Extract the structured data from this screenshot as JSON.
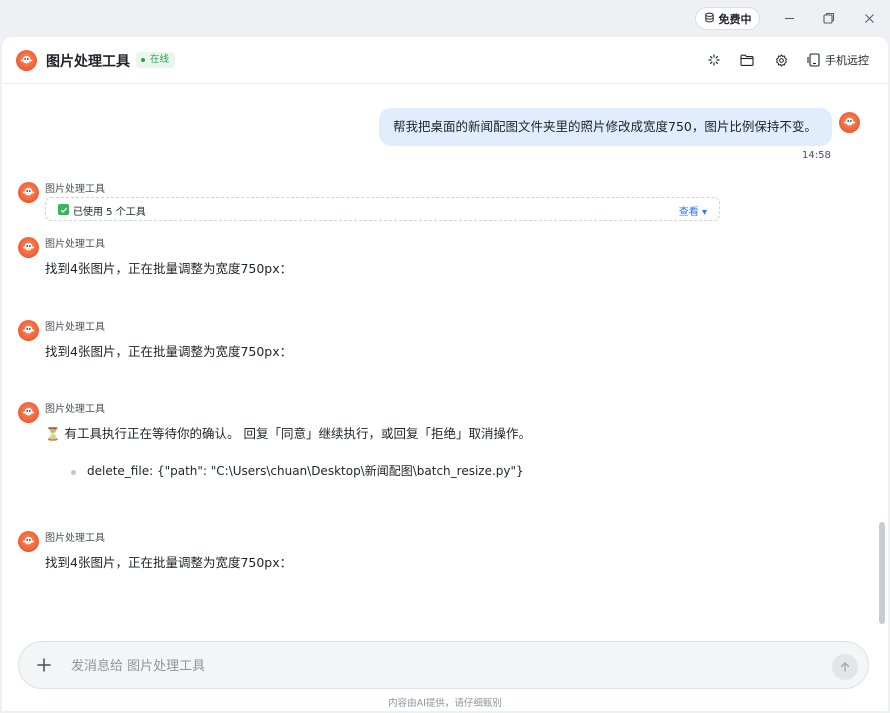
{
  "titlebar": {
    "free_label": "免费中"
  },
  "header": {
    "title": "图片处理工具",
    "status": "在线",
    "remote_label": "手机远控"
  },
  "chat": {
    "user_message": {
      "text": "帮我把桌面的新闻配图文件夹里的照片修改成宽度750，图片比例保持不变。",
      "time": "14:58"
    },
    "messages": [
      {
        "sender": "图片处理工具",
        "tool_summary": "已使用 5 个工具",
        "tool_view": "查看 ▾"
      },
      {
        "sender": "图片处理工具",
        "text": "找到4张图片，正在批量调整为宽度750px："
      },
      {
        "sender": "图片处理工具",
        "text": "找到4张图片，正在批量调整为宽度750px："
      },
      {
        "sender": "图片处理工具",
        "text": "⏳ 有工具执行正在等待你的确认。 回复「同意」继续执行，或回复「拒绝」取消操作。",
        "bullet": "delete_file: {\"path\": \"C:\\Users\\chuan\\Desktop\\新闻配图\\batch_resize.py\"}"
      },
      {
        "sender": "图片处理工具",
        "text": "找到4张图片，正在批量调整为宽度750px："
      }
    ]
  },
  "composer": {
    "placeholder": "发消息给 图片处理工具"
  },
  "footer": {
    "disclaimer": "内容由AI提供，请仔细甄别"
  },
  "colors": {
    "accent": "#3370ff",
    "online": "#2f9e54",
    "user_bubble": "#e1ecfc",
    "avatar": "#f0633a"
  }
}
